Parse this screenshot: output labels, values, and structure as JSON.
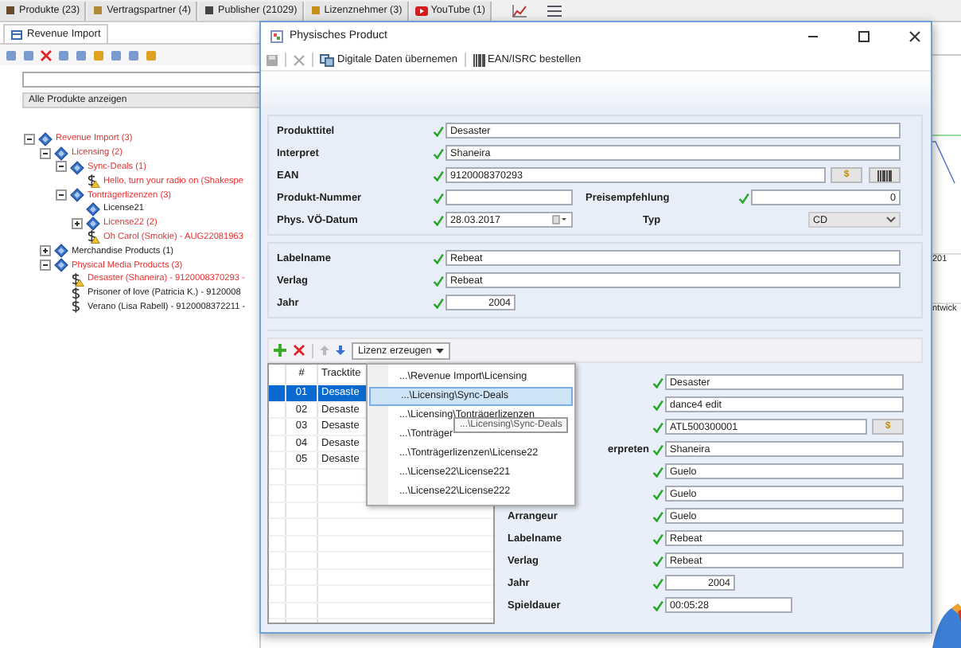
{
  "top_tabs": [
    {
      "label": "Produkte (23)"
    },
    {
      "label": "Vertragspartner (4)"
    },
    {
      "label": "Publisher (21029)"
    },
    {
      "label": "Lizenznehmer (3)"
    },
    {
      "label": "YouTube (1)"
    }
  ],
  "panel_tab": {
    "label": "Revenue Import"
  },
  "filter": {
    "value": "Alle Produkte anzeigen"
  },
  "tree": [
    {
      "label": "Revenue Import (3)",
      "kind": "folder",
      "flagged": true,
      "expanded": true,
      "children": [
        {
          "label": "Licensing (2)",
          "kind": "folder",
          "flagged": true,
          "expanded": true,
          "children": [
            {
              "label": "Sync-Deals (1)",
              "kind": "folder",
              "flagged": true,
              "expanded": true,
              "children": [
                {
                  "label": "Hello, turn your radio on (Shakespe",
                  "kind": "product",
                  "flagged": true,
                  "warning": true
                }
              ]
            },
            {
              "label": "Tonträgerlizenzen (3)",
              "kind": "folder",
              "flagged": true,
              "expanded": true,
              "children": [
                {
                  "label": "License21",
                  "kind": "folder",
                  "flagged": false
                },
                {
                  "label": "License22 (2)",
                  "kind": "folder",
                  "flagged": true,
                  "expanded": false
                },
                {
                  "label": "Oh Carol (Smokie) - AUG22081963",
                  "kind": "product",
                  "flagged": true,
                  "warning": true
                }
              ]
            }
          ]
        },
        {
          "label": "Merchandise Products (1)",
          "kind": "folder",
          "flagged": false,
          "expanded": false
        },
        {
          "label": "Physical Media Products (3)",
          "kind": "folder",
          "flagged": true,
          "expanded": true,
          "children": [
            {
              "label": "Desaster (Shaneira) - 9120008370293 -",
              "kind": "product",
              "flagged": true,
              "warning": true
            },
            {
              "label": "Prisoner of love (Patricia K.) - 9120008",
              "kind": "product",
              "flagged": false,
              "warning": false
            },
            {
              "label": "Verano (Lisa Rabell) - 9120008372211 -",
              "kind": "product",
              "flagged": false,
              "warning": false
            }
          ]
        }
      ]
    }
  ],
  "background": {
    "texts": [
      "201",
      "ntwick"
    ]
  },
  "dialog": {
    "title": "Physisches Product",
    "toolbar": [
      {
        "label": "Digitale Daten übernemen"
      },
      {
        "label": "EAN/ISRC bestellen"
      }
    ],
    "groups": [
      {
        "rows": [
          [
            {
              "label": "Produkttitel",
              "value": "Desaster",
              "kind": "text",
              "valid": true
            }
          ],
          [
            {
              "label": "Interpret",
              "value": "Shaneira",
              "kind": "text",
              "valid": true
            }
          ],
          [
            {
              "label": "EAN",
              "value": "9120008370293",
              "kind": "text",
              "valid": true,
              "price_button": "$",
              "barcode_button": true
            }
          ],
          [
            {
              "label": "Produkt-Nummer",
              "kind": "short",
              "valid": true
            },
            {
              "label": "Preisempfehlung",
              "value": "0",
              "kind": "number",
              "valid": true
            }
          ],
          [
            {
              "label": "Phys. VÖ-Datum",
              "value": "28.03.2017",
              "kind": "date",
              "valid": true
            },
            {
              "label": "Typ",
              "value": "CD",
              "kind": "select",
              "valid": false
            }
          ]
        ]
      },
      {
        "rows": [
          [
            {
              "label": "Labelname",
              "value": "Rebeat",
              "kind": "text",
              "valid": true
            }
          ],
          [
            {
              "label": "Verlag",
              "value": "Rebeat",
              "kind": "text",
              "valid": true
            }
          ],
          [
            {
              "label": "Jahr",
              "value": "2004",
              "kind": "number_short",
              "valid": true
            }
          ]
        ]
      }
    ]
  },
  "track_toolbar": {
    "menu_button": "Lizenz erzeugen"
  },
  "track_table": {
    "columns": [
      "#",
      "Tracktite"
    ],
    "rows": [
      {
        "number": "01",
        "title": "Desaste",
        "selected": true
      },
      {
        "number": "02",
        "title": "Desaste",
        "selected": false
      },
      {
        "number": "03",
        "title": "Desaste",
        "selected": false
      },
      {
        "number": "04",
        "title": "Desaste",
        "selected": false
      },
      {
        "number": "05",
        "title": "Desaste",
        "selected": false
      }
    ]
  },
  "track_fields": [
    {
      "value": "Desaster",
      "kind": "text",
      "valid": true
    },
    {
      "value": "dance4 edit",
      "kind": "text",
      "valid": true
    },
    {
      "value": "ATL500300001",
      "kind": "text",
      "valid": true,
      "price_button": "$"
    },
    {
      "label": "erpreten",
      "value": "Shaneira",
      "kind": "text",
      "valid": true
    },
    {
      "value": "Guelo",
      "kind": "text",
      "valid": true
    },
    {
      "value": "Guelo",
      "kind": "text",
      "valid": true
    },
    {
      "label": "Arrangeur",
      "value": "Guelo",
      "kind": "text",
      "valid": true
    },
    {
      "label": "Labelname",
      "value": "Rebeat",
      "kind": "text",
      "valid": true
    },
    {
      "label": "Verlag",
      "value": "Rebeat",
      "kind": "text",
      "valid": true
    },
    {
      "label": "Jahr",
      "value": "2004",
      "kind": "number_short",
      "valid": true
    },
    {
      "label": "Spieldauer",
      "value": "00:05:28",
      "kind": "short",
      "valid": true
    }
  ],
  "menu": {
    "items": [
      {
        "label": "...\\Revenue Import\\Licensing",
        "selected": false
      },
      {
        "label": "...\\Licensing\\Sync-Deals",
        "selected": true
      },
      {
        "label": "...\\Licensing\\Tonträgerlizenzen",
        "selected": false
      },
      {
        "label": "...\\Tonträger",
        "selected": false
      },
      {
        "label": "...\\Tonträgerlizenzen\\License22",
        "selected": false
      },
      {
        "label": "...\\License22\\License221",
        "selected": false
      },
      {
        "label": "...\\License22\\License222",
        "selected": false
      }
    ],
    "tooltip": "...\\Licensing\\Sync-Deals"
  }
}
